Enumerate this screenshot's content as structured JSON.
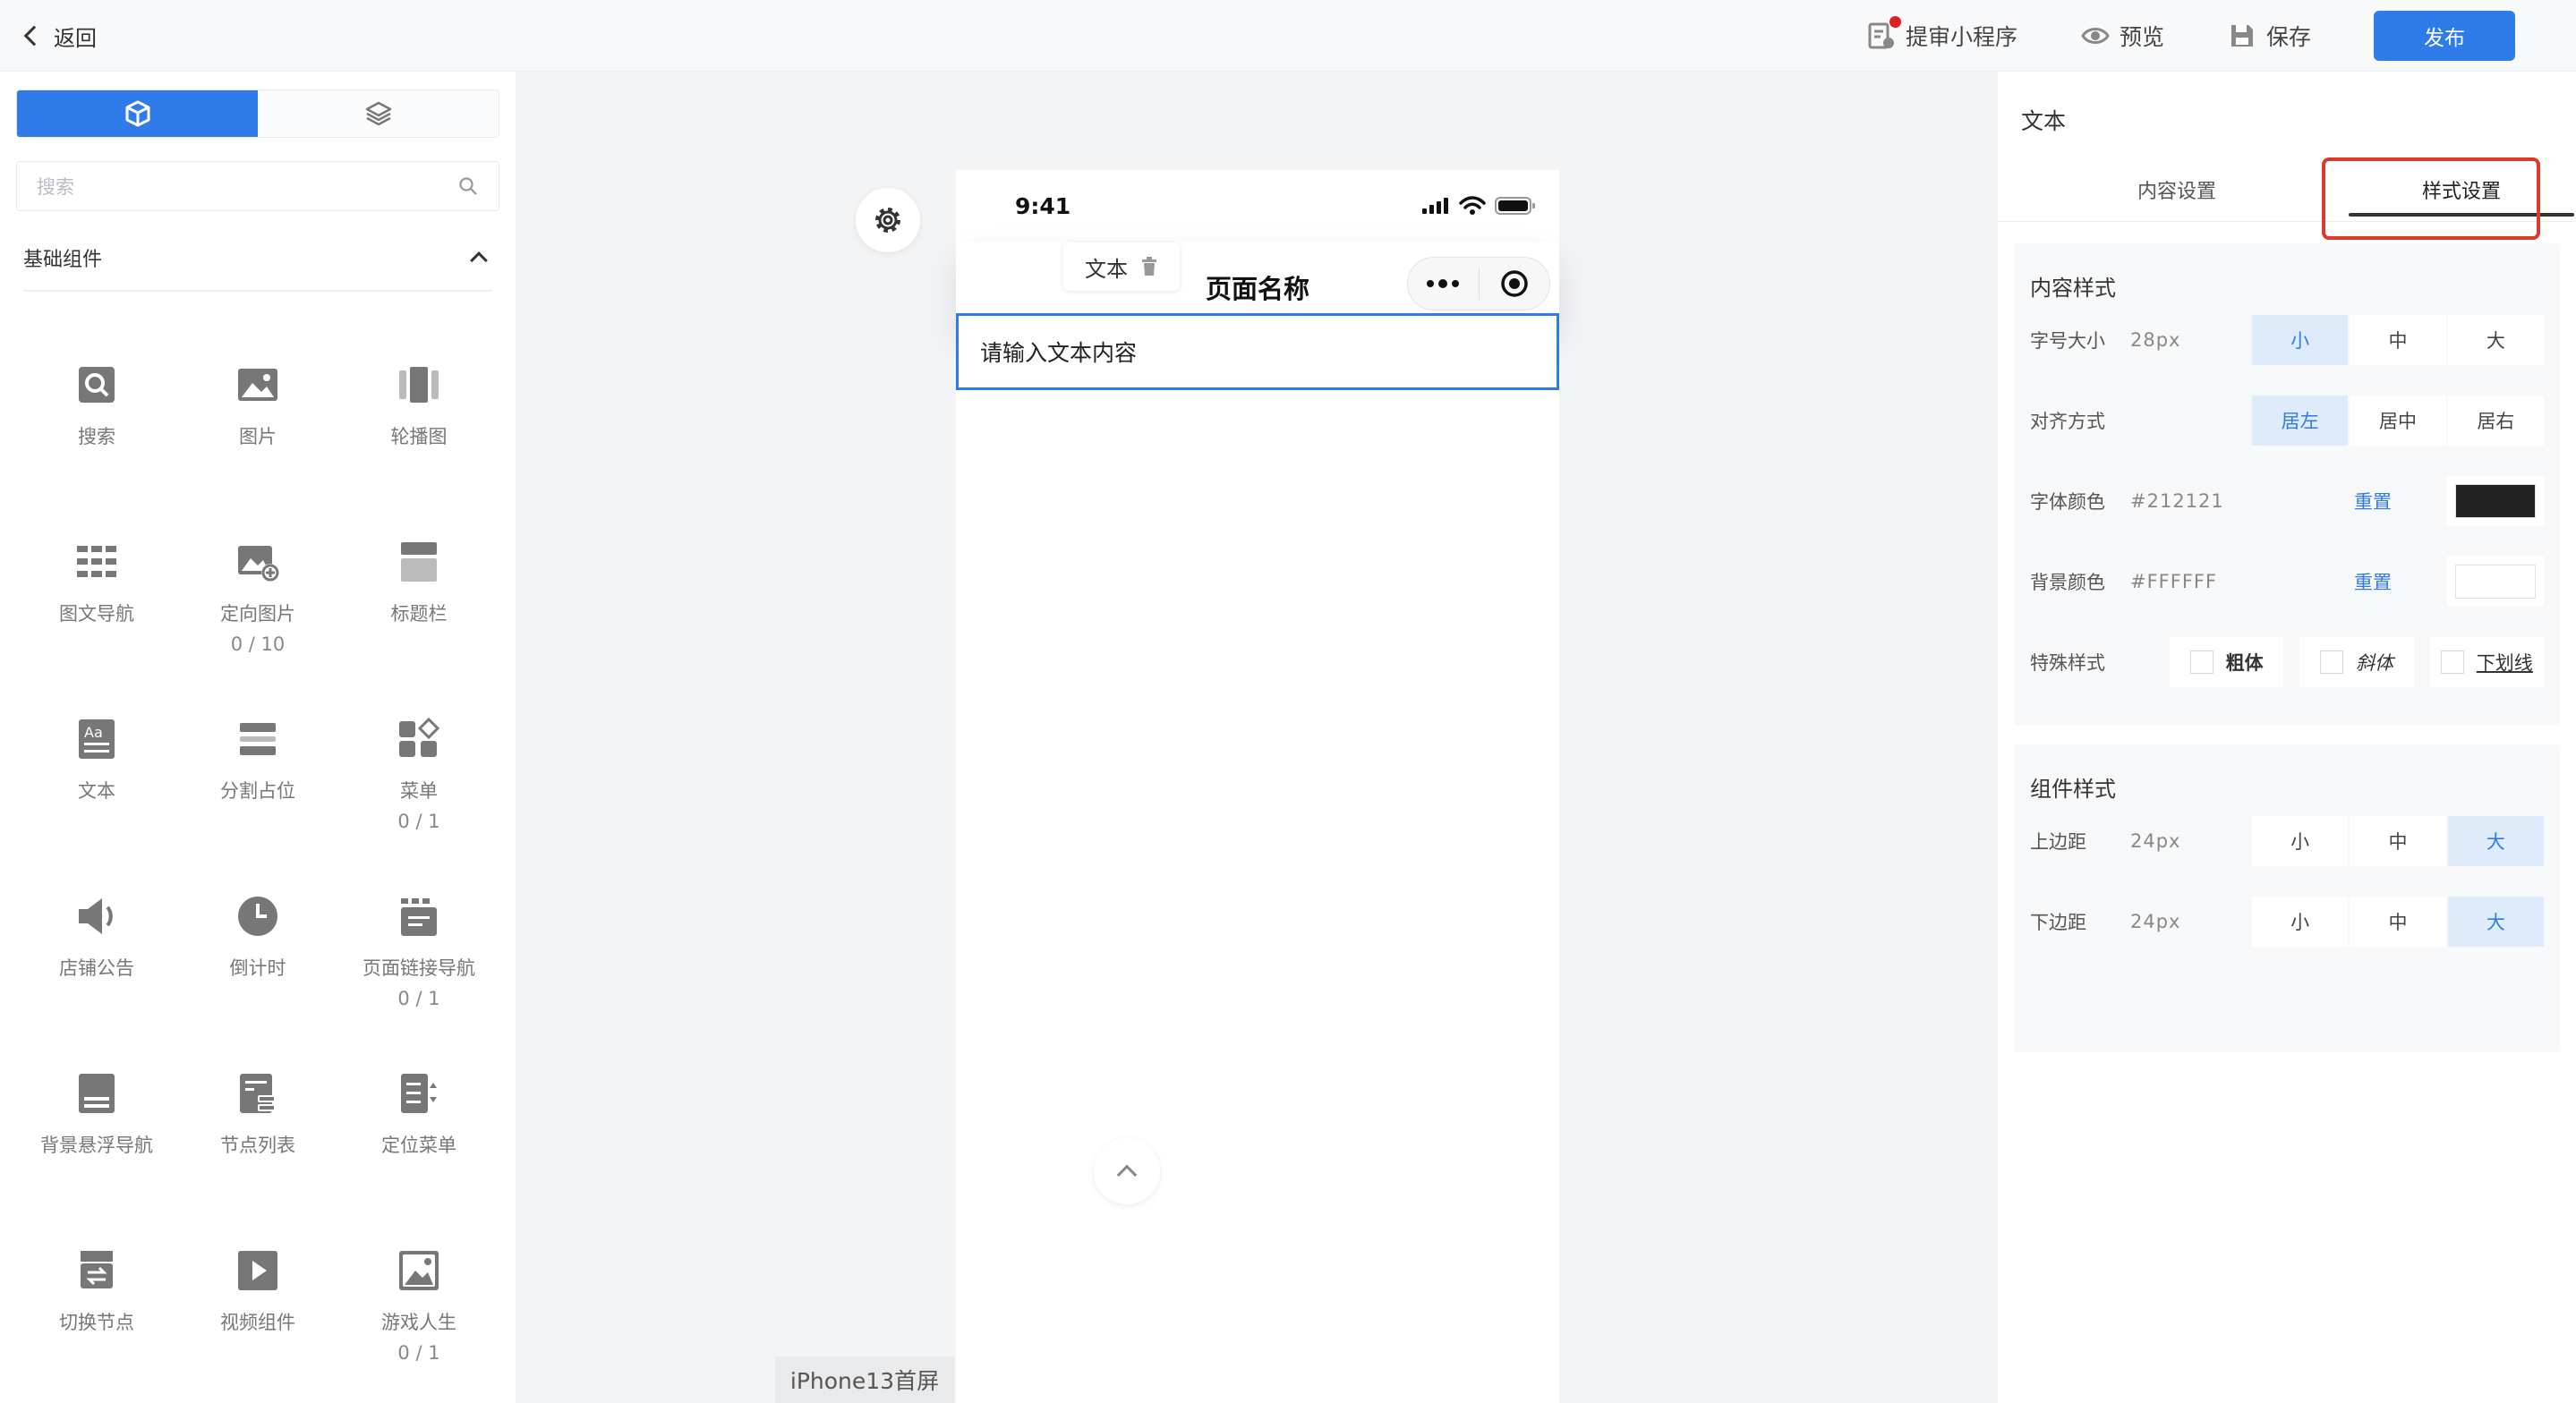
{
  "header": {
    "back_label": "返回",
    "submit_label": "提审小程序",
    "preview_label": "预览",
    "save_label": "保存",
    "publish_label": "发布"
  },
  "left": {
    "search_placeholder": "搜索",
    "section_title": "基础组件",
    "components": [
      {
        "label": "搜索",
        "icon": "search-icon",
        "count": ""
      },
      {
        "label": "图片",
        "icon": "image-icon",
        "count": ""
      },
      {
        "label": "轮播图",
        "icon": "carousel-icon",
        "count": ""
      },
      {
        "label": "图文导航",
        "icon": "grid-nav-icon",
        "count": ""
      },
      {
        "label": "定向图片",
        "icon": "image-plus-icon",
        "count": "0 / 10"
      },
      {
        "label": "标题栏",
        "icon": "title-bar-icon",
        "count": ""
      },
      {
        "label": "文本",
        "icon": "text-icon",
        "count": ""
      },
      {
        "label": "分割占位",
        "icon": "divider-icon",
        "count": ""
      },
      {
        "label": "菜单",
        "icon": "menu-icon",
        "count": "0 / 1"
      },
      {
        "label": "店铺公告",
        "icon": "speaker-icon",
        "count": ""
      },
      {
        "label": "倒计时",
        "icon": "clock-icon",
        "count": ""
      },
      {
        "label": "页面链接导航",
        "icon": "link-nav-icon",
        "count": "0 / 1"
      },
      {
        "label": "背景悬浮导航",
        "icon": "float-nav-icon",
        "count": ""
      },
      {
        "label": "节点列表",
        "icon": "node-list-icon",
        "count": ""
      },
      {
        "label": "定位菜单",
        "icon": "locate-menu-icon",
        "count": ""
      },
      {
        "label": "切换节点",
        "icon": "switch-node-icon",
        "count": ""
      },
      {
        "label": "视频组件",
        "icon": "video-icon",
        "count": ""
      },
      {
        "label": "游戏人生",
        "icon": "game-icon",
        "count": "0 / 1"
      }
    ]
  },
  "canvas": {
    "time": "9:41",
    "page_title": "页面名称",
    "text_placeholder": "请输入文本内容",
    "tag_label": "文本",
    "page_name": "iPhone13首屏"
  },
  "right": {
    "title": "文本",
    "tab_content": "内容设置",
    "tab_style": "样式设置",
    "content_style": {
      "title": "内容样式",
      "font_size_label": "字号大小",
      "font_size_value": "28px",
      "size_small": "小",
      "size_medium": "中",
      "size_large": "大",
      "align_label": "对齐方式",
      "align_left": "居左",
      "align_center": "居中",
      "align_right": "居右",
      "font_color_label": "字体颜色",
      "font_color_value": "#212121",
      "bg_color_label": "背景颜色",
      "bg_color_value": "#FFFFFF",
      "reset_label": "重置",
      "special_label": "特殊样式",
      "bold_label": "粗体",
      "italic_label": "斜体",
      "underline_label": "下划线"
    },
    "component_style": {
      "title": "组件样式",
      "margin_top_label": "上边距",
      "margin_top_value": "24px",
      "margin_bottom_label": "下边距",
      "margin_bottom_value": "24px",
      "small": "小",
      "medium": "中",
      "large": "大"
    }
  },
  "colors": {
    "accent": "#2f7bea",
    "highlight": "#e0392b",
    "font_color_swatch": "#212121",
    "bg_color_swatch": "#FFFFFF"
  }
}
